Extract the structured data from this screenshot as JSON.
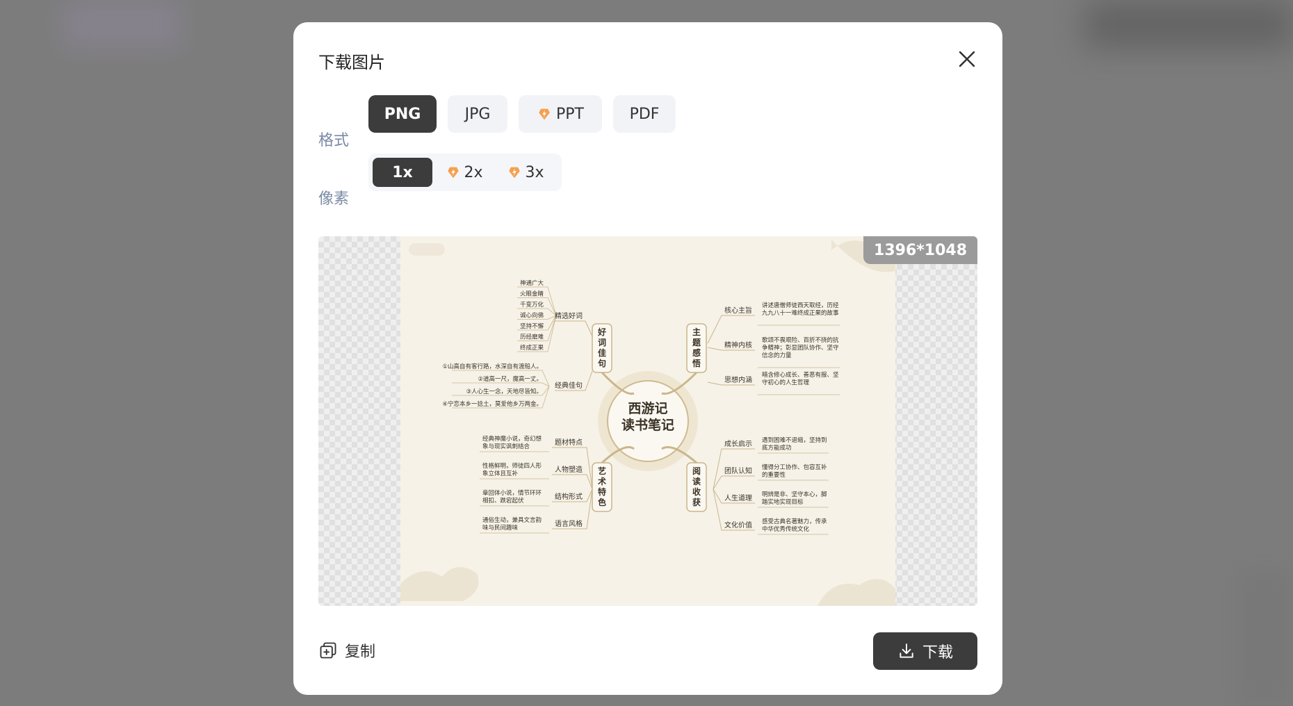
{
  "dialog": {
    "title": "下载图片",
    "close_icon": "close-icon"
  },
  "format": {
    "label": "格式",
    "options": [
      {
        "label": "PNG",
        "selected": true,
        "vip": false
      },
      {
        "label": "JPG",
        "selected": false,
        "vip": false
      },
      {
        "label": "PPT",
        "selected": false,
        "vip": true
      },
      {
        "label": "PDF",
        "selected": false,
        "vip": false
      }
    ]
  },
  "pixel": {
    "label": "像素",
    "options": [
      {
        "label": "1x",
        "selected": true,
        "vip": false
      },
      {
        "label": "2x",
        "selected": false,
        "vip": true
      },
      {
        "label": "3x",
        "selected": false,
        "vip": true
      }
    ]
  },
  "preview": {
    "size": "1396*1048",
    "mindmap": {
      "center": [
        "西游记",
        "读书笔记"
      ],
      "branches": {
        "top_left": {
          "title": [
            "好",
            "词",
            "佳",
            "句"
          ],
          "subs": [
            {
              "label": "精选好词",
              "items": [
                "神通广大",
                "火眼金睛",
                "千变万化",
                "诚心向佛",
                "坚持不懈",
                "历经磨难",
                "终成正果"
              ]
            },
            {
              "label": "经典佳句",
              "items": [
                "①山高自有客行路，水深自有渡船人。",
                "②道高一尺，魔高一丈。",
                "③人心生一念，天地尽皆知。",
                "④宁恋本乡一捻土，莫爱他乡万两金。"
              ]
            }
          ]
        },
        "bottom_left": {
          "title": [
            "艺",
            "术",
            "特",
            "色"
          ],
          "subs": [
            {
              "label": "题材特点",
              "items": [
                "经典神魔小说，奇幻想",
                "象与现实讽刺结合"
              ]
            },
            {
              "label": "人物塑造",
              "items": [
                "性格鲜明，师徒四人形",
                "象立体且互补"
              ]
            },
            {
              "label": "结构形式",
              "items": [
                "章回体小说，情节环环",
                "相扣、跌宕起伏"
              ]
            },
            {
              "label": "语言风格",
              "items": [
                "通俗生动，兼具文言韵",
                "味与民间趣味"
              ]
            }
          ]
        },
        "top_right": {
          "title": [
            "主",
            "题",
            "感",
            "悟"
          ],
          "subs": [
            {
              "label": "核心主旨",
              "items": [
                "讲述唐僧师徒西天取经，历经",
                "九九八十一难终成正果的故事"
              ]
            },
            {
              "label": "精神内核",
              "items": [
                "歌颂不畏艰险、百折不挠的抗",
                "争精神；彰显团队协作、坚守",
                "信念的力量"
              ]
            },
            {
              "label": "思想内涵",
              "items": [
                "暗含修心成长、善恶有报、坚",
                "守初心的人生哲理"
              ]
            }
          ]
        },
        "bottom_right": {
          "title": [
            "阅",
            "读",
            "收",
            "获"
          ],
          "subs": [
            {
              "label": "成长启示",
              "items": [
                "遇到困难不退缩，坚持到",
                "底方能成功"
              ]
            },
            {
              "label": "团队认知",
              "items": [
                "懂得分工协作、包容互补",
                "的重要性"
              ]
            },
            {
              "label": "人生道理",
              "items": [
                "明辨是非、坚守本心，脚",
                "踏实地实现目标"
              ]
            },
            {
              "label": "文化价值",
              "items": [
                "感受古典名著魅力，传承",
                "中华优秀传统文化"
              ]
            }
          ]
        }
      }
    }
  },
  "actions": {
    "copy_label": "复制",
    "download_label": "下载"
  },
  "colors": {
    "accent_dark": "#3c3c3c",
    "label_blue_gray": "#7a8aa5",
    "vip_orange": "#f6a04d",
    "mindmap_bg": "#f6f2e8",
    "mindmap_line": "#c9b68a"
  }
}
